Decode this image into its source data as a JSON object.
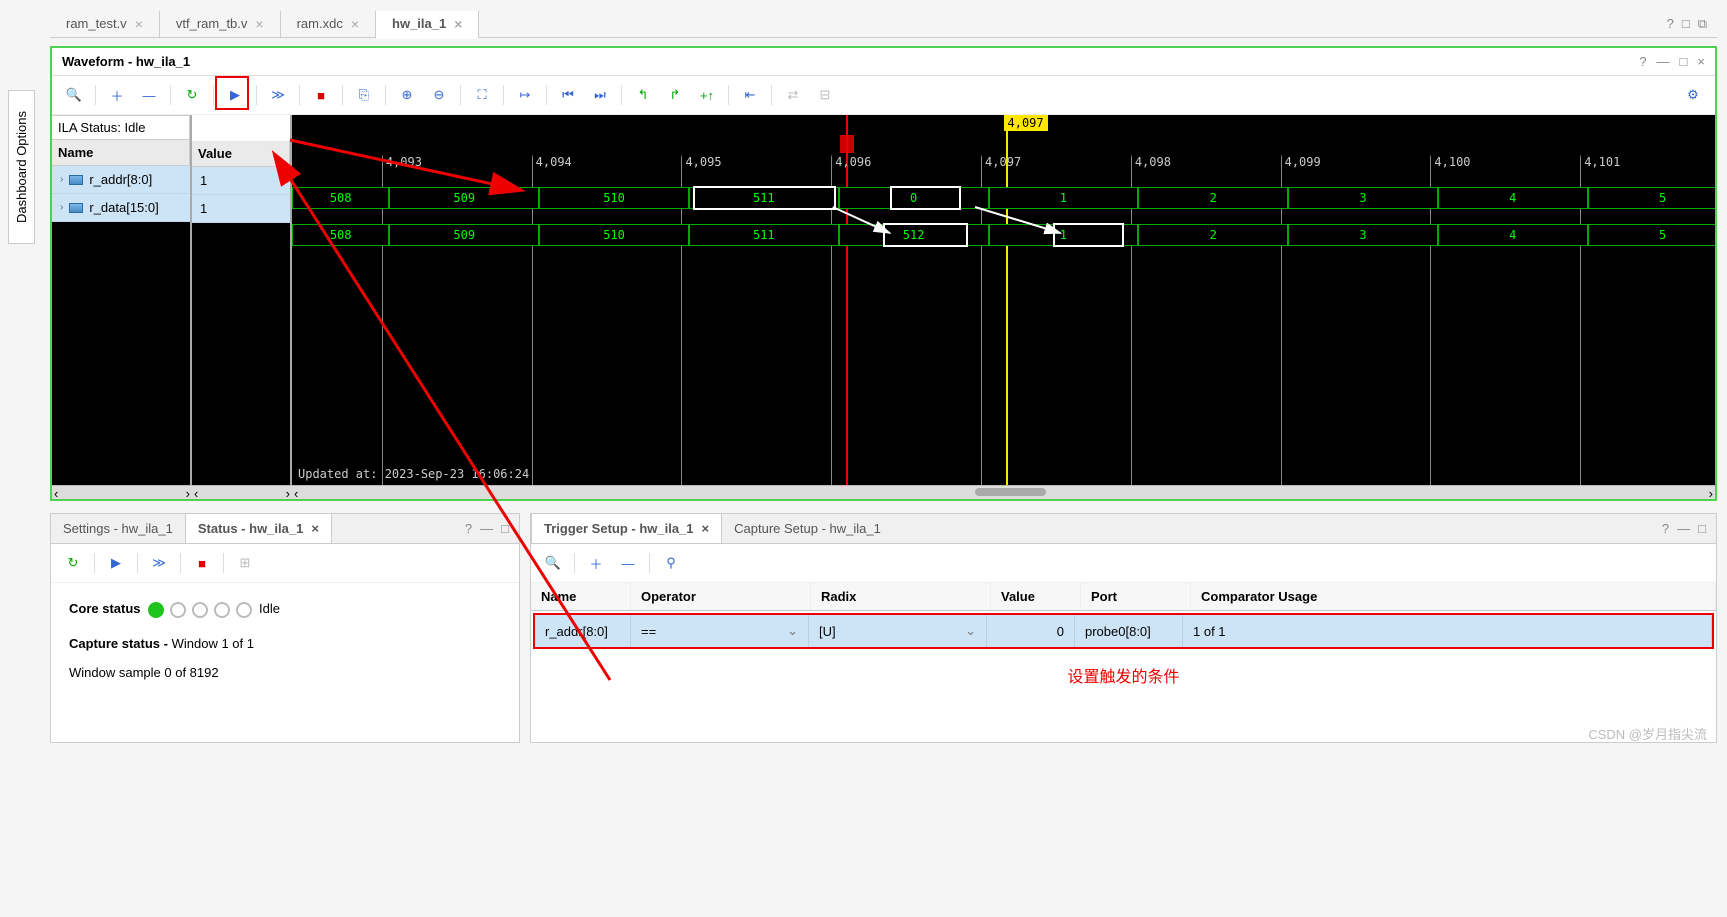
{
  "sidebar_label": "Dashboard Options",
  "tabs": [
    {
      "label": "ram_test.v"
    },
    {
      "label": "vtf_ram_tb.v"
    },
    {
      "label": "ram.xdc"
    },
    {
      "label": "hw_ila_1",
      "active": true
    }
  ],
  "waveform": {
    "title": "Waveform - hw_ila_1",
    "ila_status": "ILA Status: Idle",
    "name_col": "Name",
    "value_col": "Value",
    "signals": [
      {
        "name": "r_addr[8:0]",
        "value": "1"
      },
      {
        "name": "r_data[15:0]",
        "value": "1"
      }
    ],
    "timeticks": [
      "4,093",
      "4,094",
      "4,095",
      "4,096",
      "4,097",
      "4,098",
      "4,099",
      "4,100",
      "4,101"
    ],
    "marker_yellow": "4,097",
    "bus_addr": [
      "508",
      "509",
      "510",
      "511",
      "0",
      "1",
      "2",
      "3",
      "4",
      "5"
    ],
    "bus_data": [
      "508",
      "509",
      "510",
      "511",
      "512",
      "1",
      "2",
      "3",
      "4",
      "5"
    ],
    "updated": "Updated at: 2023-Sep-23 16:06:24"
  },
  "status_panel": {
    "tab_settings": "Settings - hw_ila_1",
    "tab_status": "Status - hw_ila_1",
    "core_label": "Core status",
    "core_state": "Idle",
    "capture_label": "Capture status -",
    "capture_window": "Window 1 of 1",
    "capture_sample": "Window sample 0 of 8192"
  },
  "trigger_panel": {
    "tab_trigger": "Trigger Setup - hw_ila_1",
    "tab_capture": "Capture Setup - hw_ila_1",
    "cols": {
      "name": "Name",
      "op": "Operator",
      "radix": "Radix",
      "value": "Value",
      "port": "Port",
      "comp": "Comparator Usage"
    },
    "row": {
      "name": "r_addr[8:0]",
      "op": "==",
      "radix": "[U]",
      "value": "0",
      "port": "probe0[8:0]",
      "comp": "1 of 1"
    },
    "note": "设置触发的条件"
  },
  "watermark": "CSDN @岁月指尖流"
}
